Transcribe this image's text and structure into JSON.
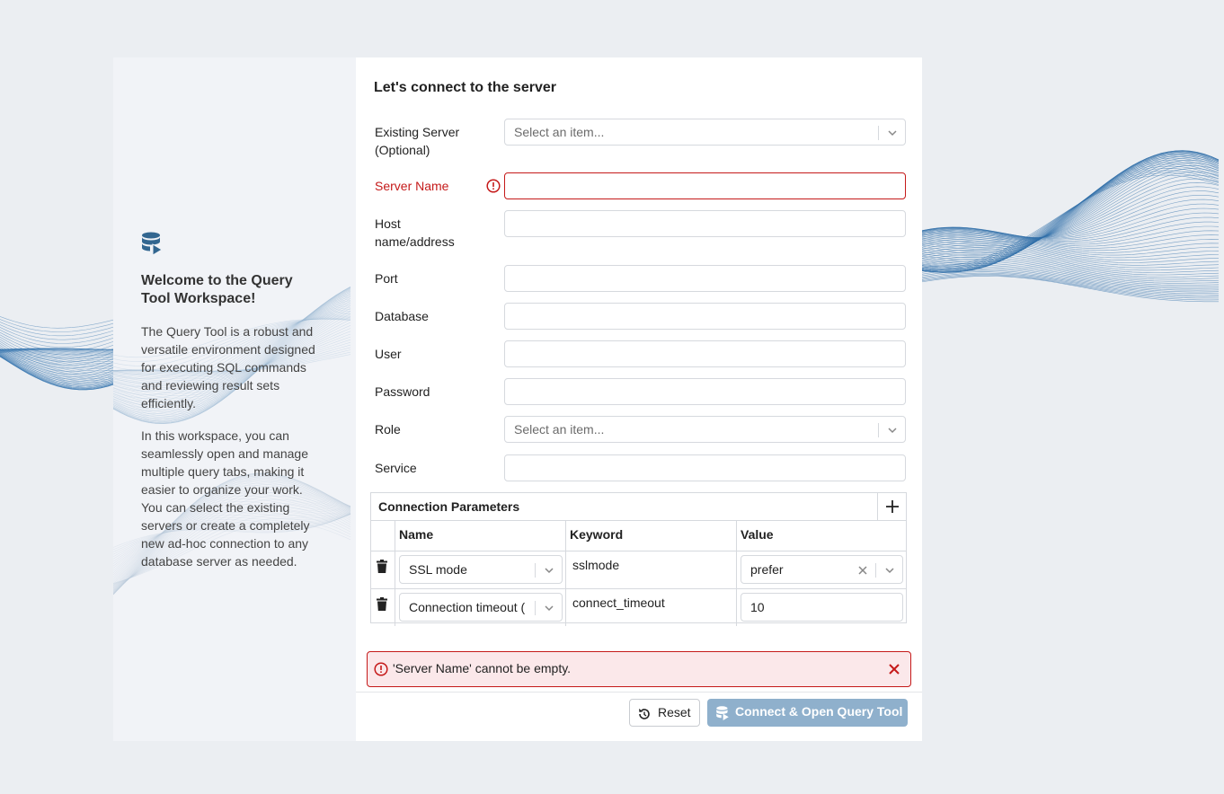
{
  "welcome": {
    "title": "Welcome to the Query Tool Workspace!",
    "paragraph1": "The Query Tool is a robust and versatile environment designed for executing SQL commands and reviewing result sets efficiently.",
    "paragraph2": "In this workspace, you can seamlessly open and manage multiple query tabs, making it easier to organize your work. You can select the existing servers or create a completely new ad-hoc connection to any database server as needed.",
    "icon": "database-play-icon"
  },
  "form": {
    "title": "Let's connect to the server",
    "existing_server": {
      "label_line1": "Existing Server",
      "label_line2": "(Optional)",
      "placeholder": "Select an item..."
    },
    "server_name": {
      "label": "Server Name",
      "value": ""
    },
    "host": {
      "label_line1": "Host",
      "label_line2": "name/address",
      "value": ""
    },
    "port": {
      "label": "Port",
      "value": ""
    },
    "database": {
      "label": "Database",
      "value": ""
    },
    "user": {
      "label": "User",
      "value": ""
    },
    "password": {
      "label": "Password",
      "value": ""
    },
    "role": {
      "label": "Role",
      "placeholder": "Select an item..."
    },
    "service": {
      "label": "Service",
      "value": ""
    }
  },
  "connection_parameters": {
    "title": "Connection Parameters",
    "columns": [
      "Name",
      "Keyword",
      "Value"
    ],
    "rows": [
      {
        "name": "SSL mode",
        "keyword": "sslmode",
        "value": "prefer"
      },
      {
        "name": "Connection timeout (",
        "keyword": "connect_timeout",
        "value": "10"
      }
    ]
  },
  "error": {
    "message": "'Server Name' cannot be empty.",
    "color": "#c51a1a"
  },
  "buttons": {
    "reset": "Reset",
    "connect": "Connect & Open Query Tool"
  },
  "colors": {
    "accent": "#326690",
    "connect_disabled": "#8fb0cc",
    "background": "#ebeef2"
  }
}
